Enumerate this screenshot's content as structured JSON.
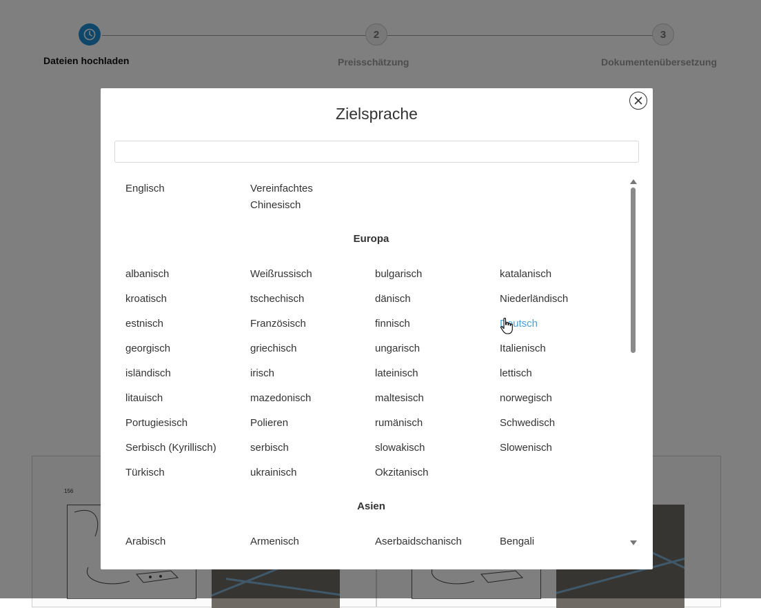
{
  "stepper": {
    "steps": [
      {
        "number": "",
        "label": "Dateien hochladen",
        "state": "active"
      },
      {
        "number": "2",
        "label": "Preisschätzung",
        "state": "pending"
      },
      {
        "number": "3",
        "label": "Dokumentenübersetzung",
        "state": "pending"
      }
    ]
  },
  "preview": {
    "sketch_number": "156"
  },
  "modal": {
    "title": "Zielsprache",
    "search_value": "",
    "top_languages": [
      "Englisch",
      "Vereinfachtes Chinesisch"
    ],
    "sections": [
      {
        "name": "Europa",
        "languages": [
          "albanisch",
          "Weißrussisch",
          "bulgarisch",
          "katalanisch",
          "kroatisch",
          "tschechisch",
          "dänisch",
          "Niederländisch",
          "estnisch",
          "Französisch",
          "finnisch",
          "Deutsch",
          "georgisch",
          "griechisch",
          "ungarisch",
          "Italienisch",
          "isländisch",
          "irisch",
          "lateinisch",
          "lettisch",
          "litauisch",
          "mazedonisch",
          "maltesisch",
          "norwegisch",
          "Portugiesisch",
          "Polieren",
          "rumänisch",
          "Schwedisch",
          "Serbisch (Kyrillisch)",
          "serbisch",
          "slowakisch",
          "Slowenisch",
          "Türkisch",
          "ukrainisch",
          "Okzitanisch"
        ]
      },
      {
        "name": "Asien",
        "languages": [
          "Arabisch",
          "Armenisch",
          "Aserbaidschanisch",
          "Bengali"
        ]
      }
    ],
    "hovered_language": "Deutsch"
  },
  "colors": {
    "accent": "#1f8fd6",
    "link_hover": "#4a9ed8",
    "overlay": "rgba(0,0,0,0.5)",
    "text": "#333333"
  },
  "icons": {
    "close": "close-icon",
    "step_active": "clock-icon",
    "cursor": "hand-pointer-icon"
  }
}
